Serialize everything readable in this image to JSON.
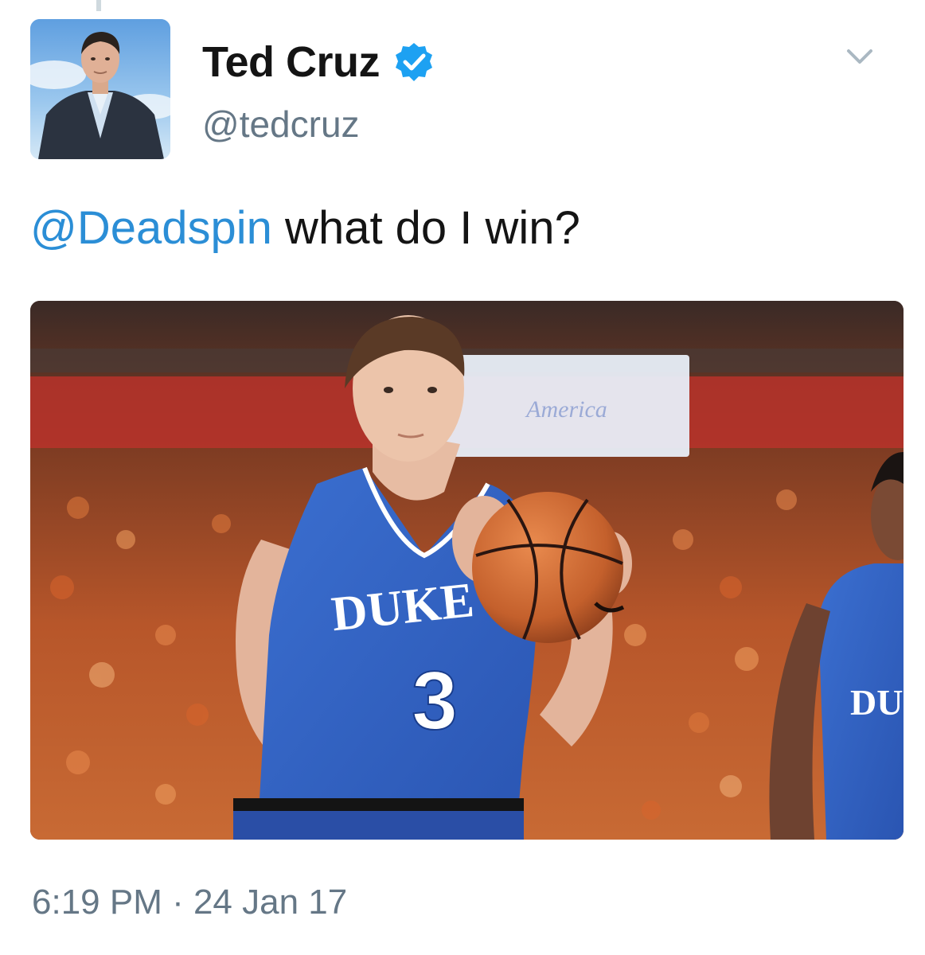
{
  "tweet": {
    "author": {
      "display_name": "Ted Cruz",
      "handle": "@tedcruz",
      "verified": true,
      "avatar_icon": "profile-photo"
    },
    "mention": "@Deadspin",
    "text_rest": " what do I win?",
    "timestamp": "6:19 PM · 24 Jan 17",
    "media": {
      "jersey_word": "DUKE",
      "jersey_number": "3",
      "second_jersey_word": "DU",
      "banner_text": "America"
    }
  },
  "colors": {
    "link": "#2b8ed6",
    "verified": "#1da1f2",
    "secondary_text": "#657786",
    "primary_text": "#141414",
    "jersey_blue": "#2f5fc4"
  },
  "icons": {
    "menu": "chevron-down-icon",
    "badge": "verified-badge-icon"
  }
}
